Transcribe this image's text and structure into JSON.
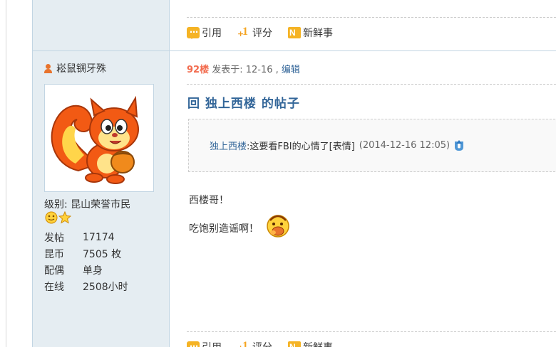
{
  "actions_top": [
    {
      "label": "引用",
      "icon": "quote-icon"
    },
    {
      "label": "评分",
      "icon": "rate-icon"
    },
    {
      "label": "新鲜事",
      "icon": "news-icon"
    }
  ],
  "author": {
    "name": "崧鼠锎牙殊",
    "level_label": "级别: 昆山荣誉市民",
    "stats": [
      {
        "key": "发帖",
        "value": "17174"
      },
      {
        "key": "昆币",
        "value": "7505 枚"
      },
      {
        "key": "配偶",
        "value": "单身"
      },
      {
        "key": "在线",
        "value": "2508小时"
      }
    ]
  },
  "post": {
    "floor": "92楼",
    "posted_prefix": " 发表于: 12-16 , ",
    "edit": "编辑",
    "title": "回  独上西楼  的帖子",
    "quote_author": "独上西楼",
    "quote_text": ":这要看FBI的心情了[表情]",
    "quote_time": "(2014-12-16 12:05)",
    "line1": "西楼哥！",
    "line2": "吃饱别造谣啊！"
  },
  "actions_bottom": [
    {
      "label": "引用",
      "icon": "quote-icon"
    },
    {
      "label": "评分",
      "icon": "rate-icon"
    },
    {
      "label": "新鲜事",
      "icon": "news-icon"
    }
  ],
  "colors": {
    "link": "#336699",
    "floor": "#f26c4f",
    "sidebar_bg": "#e5edf2",
    "border": "#c2d5e3",
    "icon_accent": "#f5b324"
  }
}
